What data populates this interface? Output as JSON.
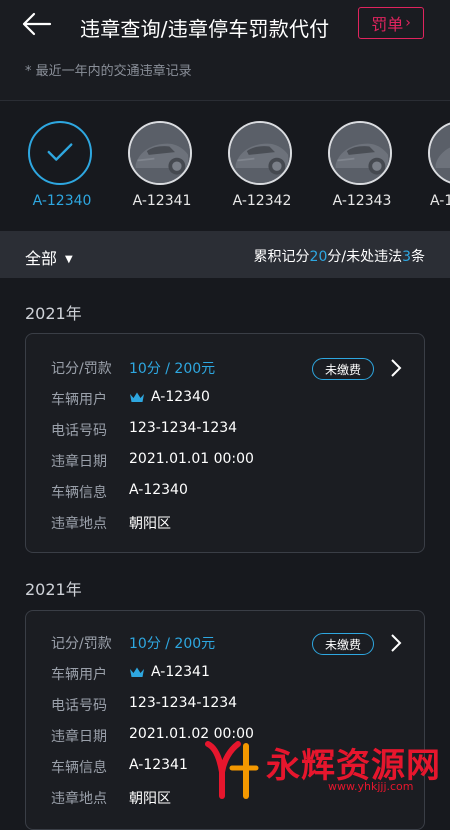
{
  "header": {
    "title": "违章查询/违章停车罚款代付",
    "fine_button": "罚单",
    "fine_chevron": "›",
    "subtitle": "* 最近一年内的交通违章记录"
  },
  "cars": [
    {
      "plate": "A-12340",
      "selected": true
    },
    {
      "plate": "A-12341",
      "selected": false
    },
    {
      "plate": "A-12342",
      "selected": false
    },
    {
      "plate": "A-12343",
      "selected": false
    },
    {
      "plate": "A-1",
      "selected": false
    }
  ],
  "filter": {
    "label": "全部",
    "summary_prefix": "累积记分",
    "points": "20",
    "summary_mid": "分/未处违法",
    "count": "3",
    "summary_suffix": "条"
  },
  "records": [
    {
      "year": "2021年",
      "status": "未缴费",
      "fields": [
        {
          "label": "记分/罚款",
          "value": "10分 / 200元"
        },
        {
          "label": "车辆用户",
          "value": "A-12340"
        },
        {
          "label": "电话号码",
          "value": "123-1234-1234"
        },
        {
          "label": "违章日期",
          "value": "2021.01.01 00:00"
        },
        {
          "label": "车辆信息",
          "value": "A-12340"
        },
        {
          "label": "违章地点",
          "value": "朝阳区"
        }
      ]
    },
    {
      "year": "2021年",
      "status": "未缴费",
      "fields": [
        {
          "label": "记分/罚款",
          "value": "10分 / 200元"
        },
        {
          "label": "车辆用户",
          "value": "A-12341"
        },
        {
          "label": "电话号码",
          "value": "123-1234-1234"
        },
        {
          "label": "违章日期",
          "value": "2021.01.02 00:00"
        },
        {
          "label": "车辆信息",
          "value": "A-12341"
        },
        {
          "label": "违章地点",
          "value": "朝阳区"
        }
      ]
    }
  ],
  "watermark": {
    "text": "永辉资源网",
    "url": "www.yhkjjj.com"
  },
  "colors": {
    "accent": "#2ea7e0",
    "fine": "#e0245e",
    "background": "#17191e"
  }
}
